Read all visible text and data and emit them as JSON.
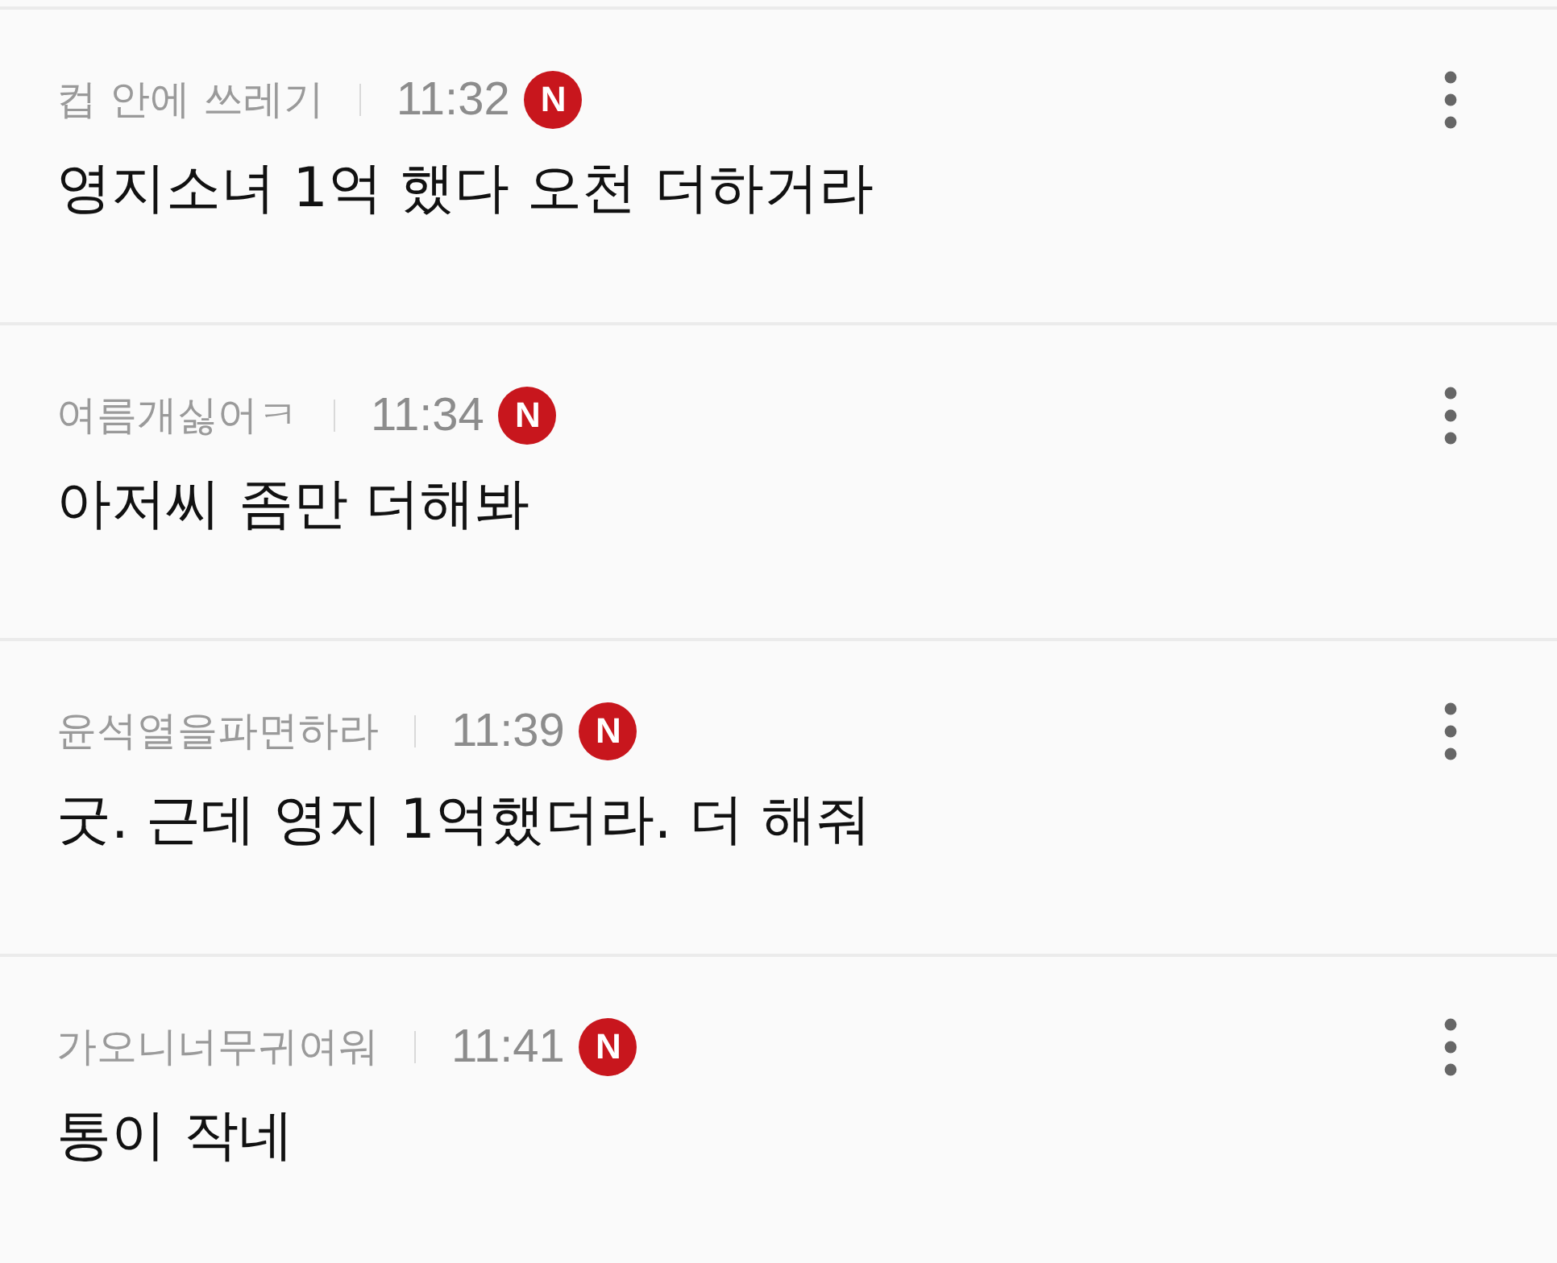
{
  "comments": [
    {
      "nickname": "컵 안에 쓰레기",
      "time": "11:32",
      "badge": "N",
      "text": "영지소녀 1억 했다 오천 더하거라"
    },
    {
      "nickname": "여름개싫어ㅋ",
      "time": "11:34",
      "badge": "N",
      "text": "아저씨 좀만 더해봐"
    },
    {
      "nickname": "윤석열을파면하라",
      "time": "11:39",
      "badge": "N",
      "text": "굿. 근데 영지 1억했더라. 더 해줘"
    },
    {
      "nickname": "가오니너무귀여워",
      "time": "11:41",
      "badge": "N",
      "text": "통이 작네"
    }
  ]
}
